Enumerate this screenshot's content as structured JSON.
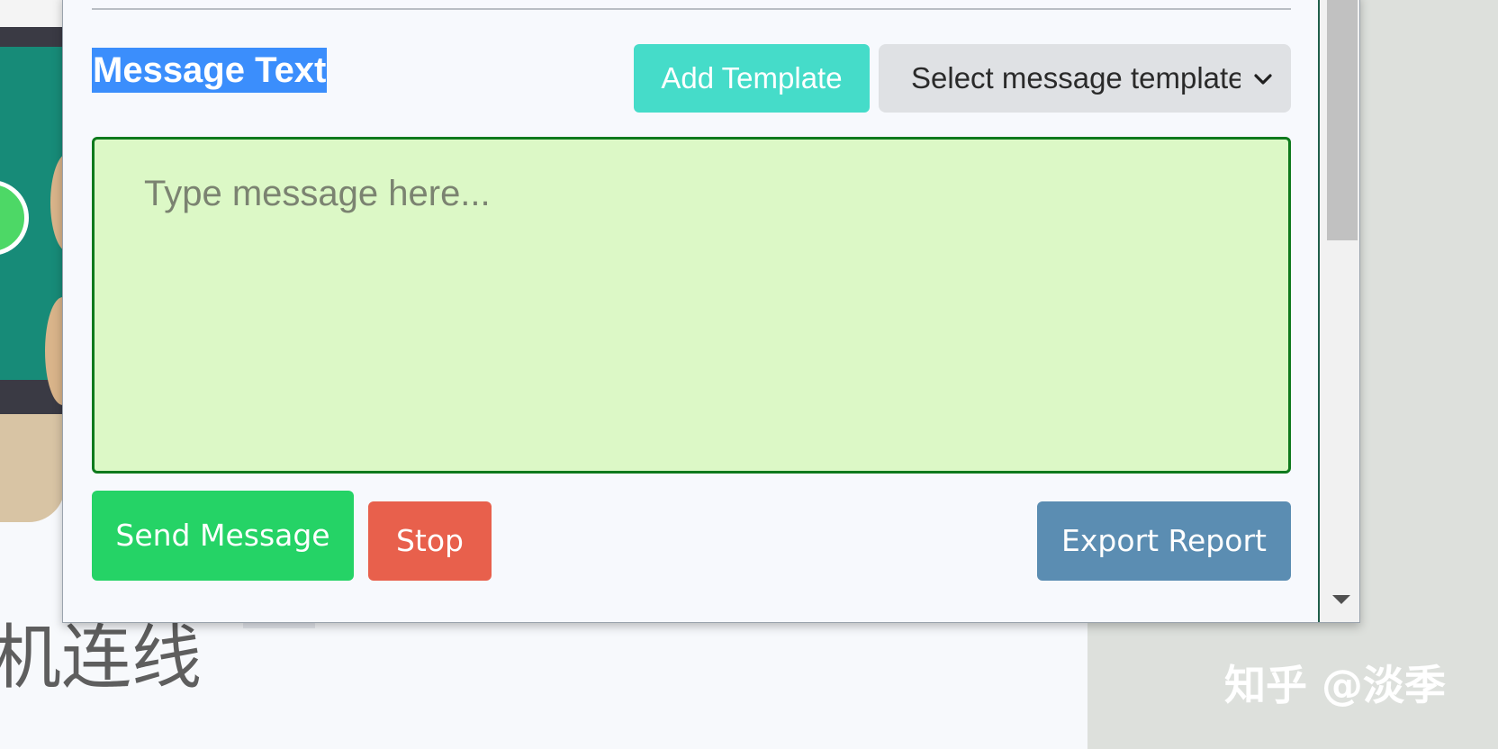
{
  "background_page": {
    "heading_fragment": "机连线"
  },
  "watermark": {
    "text": "知乎 @淡季"
  },
  "panel": {
    "message_label": "Message Text",
    "add_template_label": "Add Template",
    "template_select": {
      "selected_value": "Select message template"
    },
    "message_input": {
      "value": "",
      "placeholder": "Type message here..."
    },
    "actions": {
      "send_label": "Send Message",
      "stop_label": "Stop",
      "export_label": "Export Report"
    }
  },
  "colors": {
    "label_highlight": "#3b8efc",
    "add_template": "#45dcc9",
    "message_box_bg": "#dcf8c6",
    "message_box_border": "#0e7a1d",
    "send_button": "#25d366",
    "stop_button": "#e8604c",
    "export_button": "#5b8db2"
  },
  "icons": {
    "select_arrow": "chevron-down-icon",
    "scroll_down": "scroll-down-arrow-icon"
  }
}
